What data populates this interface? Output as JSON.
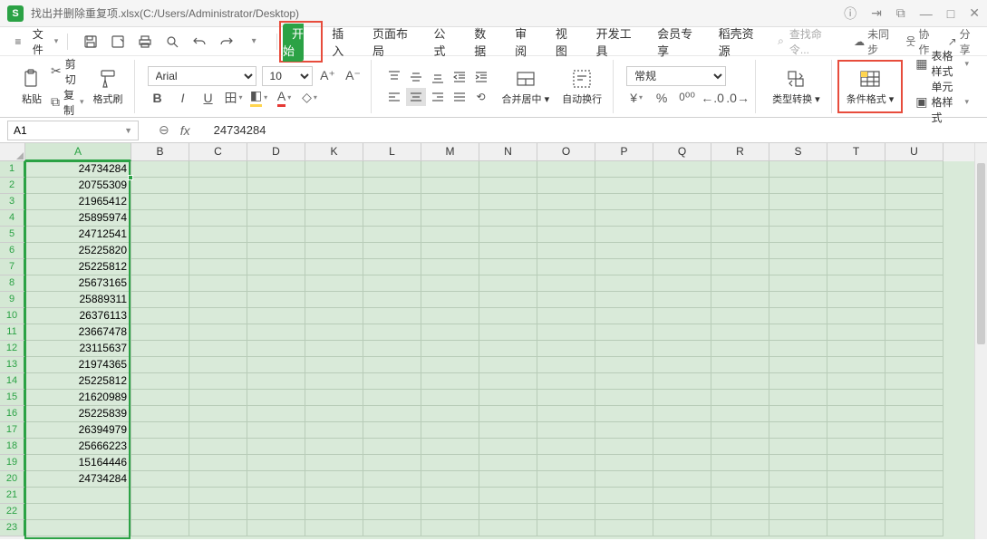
{
  "window": {
    "app_glyph": "S",
    "title": "找出并删除重复项.xlsx(C:/Users/Administrator/Desktop)"
  },
  "menu": {
    "file": "文件",
    "tabs": [
      "开始",
      "插入",
      "页面布局",
      "公式",
      "数据",
      "审阅",
      "视图",
      "开发工具",
      "会员专享",
      "稻壳资源"
    ],
    "active_tab_index": 0,
    "search_placeholder": "查找命令...",
    "status": {
      "unsync": "未同步",
      "collab": "协作",
      "share": "分享"
    }
  },
  "ribbon": {
    "paste": "粘贴",
    "cut": "剪切",
    "copy": "复制",
    "format_painter": "格式刷",
    "font_name": "Arial",
    "font_size": "10",
    "merge_center": "合并居中",
    "wrap_text": "自动换行",
    "number_format": "常规",
    "type_convert": "类型转换",
    "cond_format": "条件格式",
    "table_style": "表格样式",
    "cell_style": "单元格样式"
  },
  "formula_bar": {
    "name_box": "A1",
    "value": "24734284"
  },
  "grid": {
    "col_widths": {
      "A": 117,
      "default": 64
    },
    "columns": [
      "A",
      "B",
      "C",
      "D",
      "K",
      "L",
      "M",
      "N",
      "O",
      "P",
      "Q",
      "R",
      "S",
      "T",
      "U"
    ],
    "selected_col": "A",
    "visible_rows": 23,
    "values": [
      "24734284",
      "20755309",
      "21965412",
      "25895974",
      "24712541",
      "25225820",
      "25225812",
      "25673165",
      "25889311",
      "26376113",
      "23667478",
      "23115637",
      "21974365",
      "25225812",
      "21620989",
      "25225839",
      "26394979",
      "25666223",
      "15164446",
      "24734284"
    ]
  }
}
